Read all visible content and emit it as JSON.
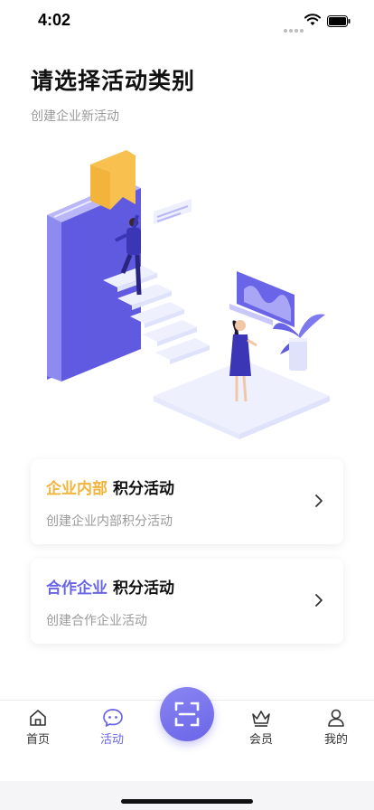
{
  "status_bar": {
    "time": "4:02"
  },
  "header": {
    "title": "请选择活动类别",
    "subtitle": "创建企业新活动"
  },
  "cards": [
    {
      "accent_text": "企业内部",
      "title_text": "积分活动",
      "description": "创建企业内部积分活动",
      "accent_color": "#f3b43b",
      "icon": "chevron-right-icon"
    },
    {
      "accent_text": "合作企业",
      "title_text": "积分活动",
      "description": "创建合作企业活动",
      "accent_color": "#6a65e8",
      "icon": "chevron-right-icon"
    }
  ],
  "tab_bar": {
    "tabs": [
      {
        "label": "首页",
        "icon": "home-icon",
        "active": false
      },
      {
        "label": "活动",
        "icon": "chat-bubble-icon",
        "active": true
      },
      {
        "label": "会员",
        "icon": "crown-icon",
        "active": false
      },
      {
        "label": "我的",
        "icon": "person-icon",
        "active": false
      }
    ],
    "center_button_icon": "scan-icon"
  },
  "colors": {
    "accent_purple": "#6a65e8",
    "accent_gold": "#f3b43b",
    "text_secondary": "#9a9a9a"
  }
}
